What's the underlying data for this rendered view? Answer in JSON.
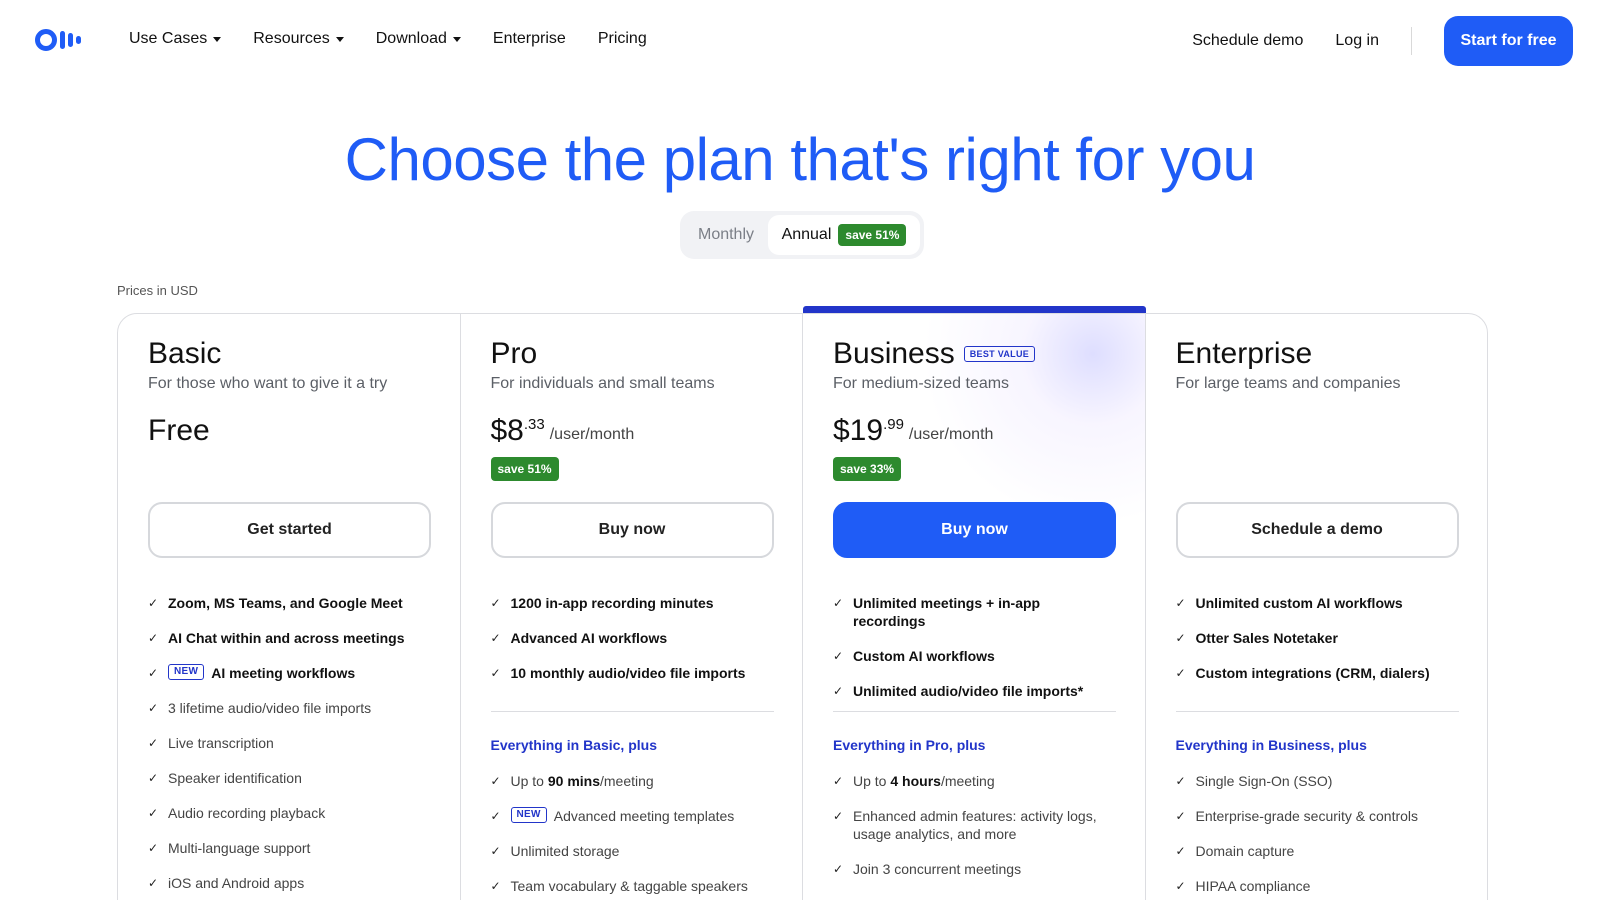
{
  "nav": {
    "items": [
      {
        "label": "Use Cases",
        "dropdown": true
      },
      {
        "label": "Resources",
        "dropdown": true
      },
      {
        "label": "Download",
        "dropdown": true
      },
      {
        "label": "Enterprise",
        "dropdown": false
      },
      {
        "label": "Pricing",
        "dropdown": false
      }
    ],
    "schedule_demo": "Schedule demo",
    "log_in": "Log in",
    "start_free": "Start for free"
  },
  "hero": {
    "title": "Choose the plan that's right for you",
    "toggle_monthly": "Monthly",
    "toggle_annual": "Annual",
    "annual_save": "save 51%"
  },
  "prices_note": "Prices in USD",
  "colors": {
    "accent": "#1f5cf6",
    "deep_blue": "#2235c9",
    "save_green": "#2d8a2e"
  },
  "plans": [
    {
      "name": "Basic",
      "desc": "For those who want to give it a try",
      "price_text": "Free",
      "cta": "Get started",
      "features": [
        {
          "text": "Zoom, MS Teams, and Google Meet",
          "bold": true
        },
        {
          "text": "AI Chat within and across meetings",
          "bold": true
        },
        {
          "badge": "NEW",
          "text": "AI meeting workflows",
          "bold": true
        },
        {
          "text": "3 lifetime audio/video file imports",
          "bold": false
        },
        {
          "text": "Live transcription",
          "bold": false
        },
        {
          "text": "Speaker identification",
          "bold": false
        },
        {
          "text": "Audio recording playback",
          "bold": false
        },
        {
          "text": "Multi-language support",
          "bold": false
        },
        {
          "text": "iOS and Android apps",
          "bold": false
        }
      ]
    },
    {
      "name": "Pro",
      "desc": "For individuals and small teams",
      "price_dollars": "$8",
      "price_cents": ".33",
      "price_per": "/user/month",
      "save": "save 51%",
      "cta": "Buy now",
      "features": [
        {
          "text": "1200 in-app recording minutes"
        },
        {
          "text": "Advanced AI workflows"
        },
        {
          "text": "10 monthly audio/video file imports"
        }
      ],
      "plus_heading": "Everything in Basic, plus",
      "extras": [
        {
          "pre": "Up to ",
          "hl": "90 mins",
          "post": "/meeting"
        },
        {
          "badge": "NEW",
          "pre": "Advanced meeting templates"
        },
        {
          "pre": "Unlimited storage"
        },
        {
          "pre": "Team vocabulary & taggable speakers"
        }
      ]
    },
    {
      "name": "Business",
      "badge": "BEST VALUE",
      "desc": "For medium-sized teams",
      "price_dollars": "$19",
      "price_cents": ".99",
      "price_per": "/user/month",
      "save": "save 33%",
      "cta": "Buy now",
      "features": [
        {
          "text": "Unlimited meetings + in-app recordings"
        },
        {
          "text": "Custom AI workflows"
        },
        {
          "text": "Unlimited audio/video file imports*"
        }
      ],
      "plus_heading": "Everything in Pro, plus",
      "extras": [
        {
          "pre": "Up to ",
          "hl": "4 hours",
          "post": "/meeting"
        },
        {
          "pre": "Enhanced admin features: activity logs, usage analytics, and more"
        },
        {
          "pre": "Join 3 concurrent meetings"
        }
      ]
    },
    {
      "name": "Enterprise",
      "desc": "For large teams and companies",
      "cta": "Schedule a demo",
      "features": [
        {
          "text": "Unlimited custom AI workflows"
        },
        {
          "text": "Otter Sales Notetaker"
        },
        {
          "text": "Custom integrations (CRM, dialers)"
        }
      ],
      "plus_heading": "Everything in Business, plus",
      "extras": [
        {
          "pre": "Single Sign-On (SSO)"
        },
        {
          "pre": "Enterprise-grade security & controls"
        },
        {
          "pre": "Domain capture"
        },
        {
          "pre": "HIPAA compliance"
        }
      ]
    }
  ]
}
